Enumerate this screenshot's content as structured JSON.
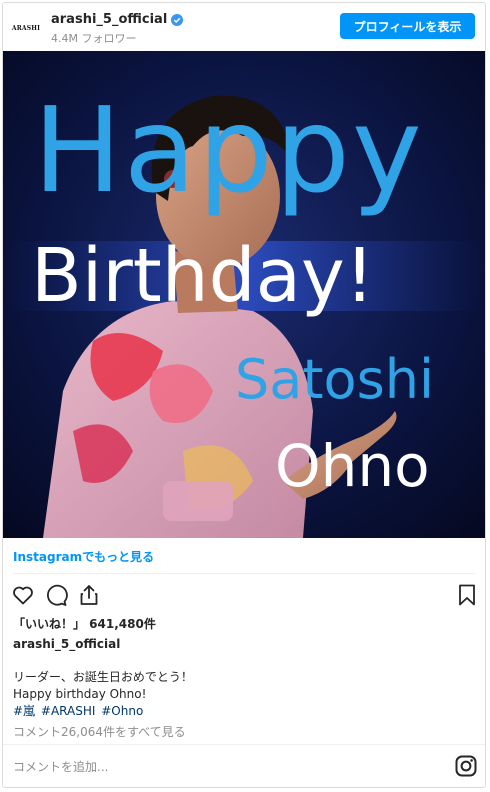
{
  "header": {
    "avatar_text": "ARASHI",
    "username": "arashi_5_official",
    "followers": "4.4M フォロワー",
    "profile_button": "プロフィールを表示"
  },
  "photo": {
    "overlay": {
      "line1": "Happy",
      "line2": "Birthday!",
      "line3": "Satoshi",
      "line4": "Ohno"
    }
  },
  "colors": {
    "accent": "#0095f6",
    "overlay_blue": "#2fa3e6",
    "hashtag": "#00376b",
    "muted": "#8e8e8e"
  },
  "more_link": "Instagramでもっと見る",
  "actions": {
    "icons": [
      "heart-icon",
      "comment-icon",
      "share-icon",
      "bookmark-icon"
    ]
  },
  "likes": "「いいね！」 641,480件",
  "caption": {
    "username": "arashi_5_official",
    "line1": "リーダー、お誕生日おめでとう！",
    "line2": "Happy birthday Ohno!",
    "hashtags": [
      "#嵐",
      "#ARASHI",
      "#Ohno"
    ]
  },
  "view_comments": "コメント26,064件をすべて見る",
  "comment_placeholder": "コメントを追加..."
}
